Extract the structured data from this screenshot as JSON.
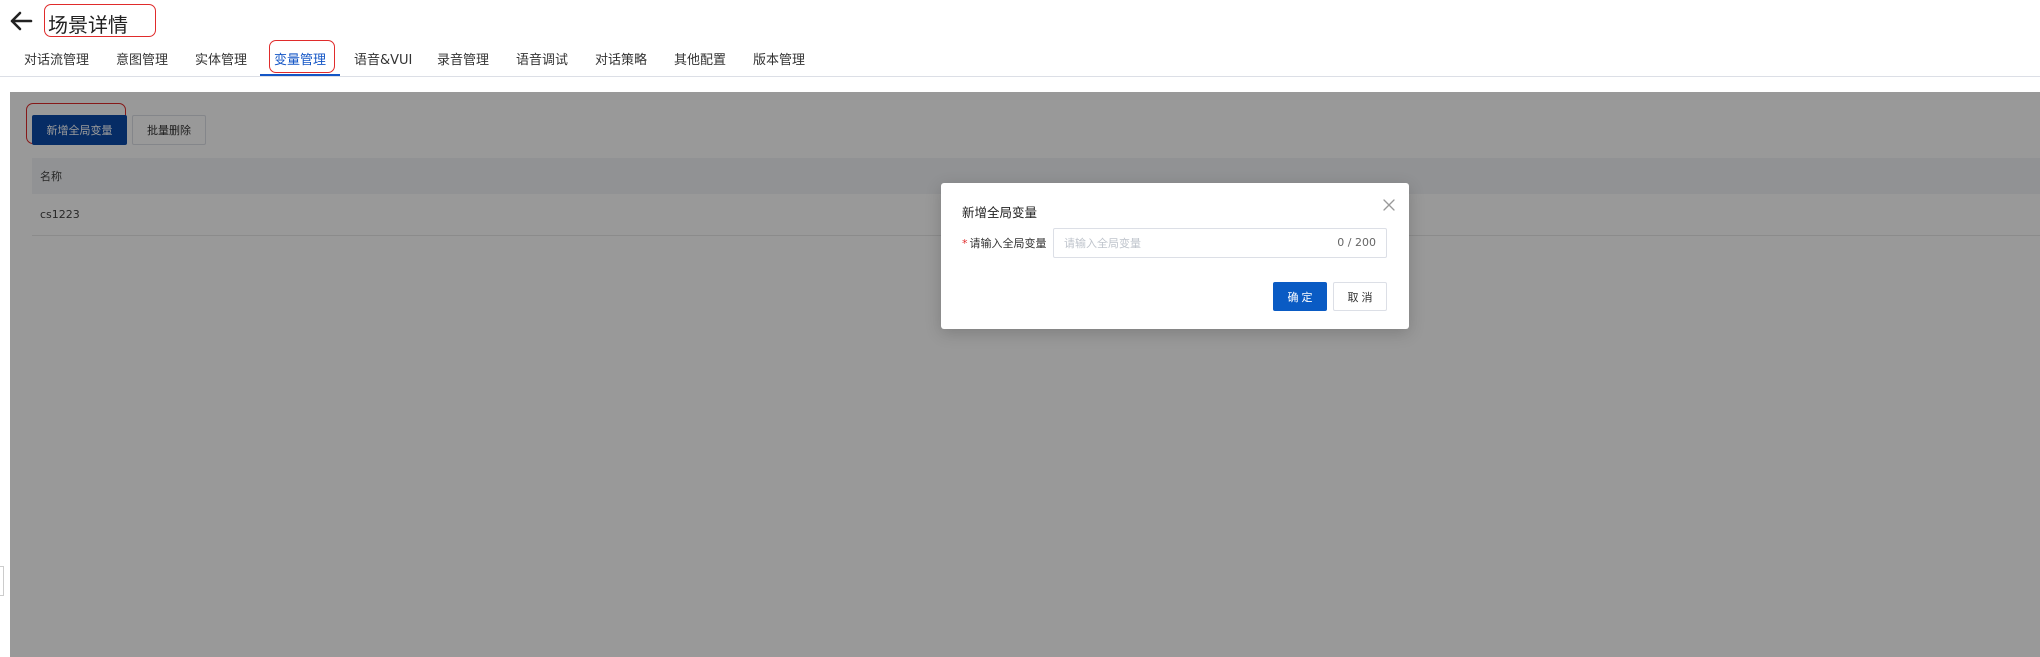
{
  "header": {
    "back_icon": "arrow-left-icon",
    "title": "场景详情"
  },
  "tabs": [
    {
      "label": "对话流管理",
      "active": false
    },
    {
      "label": "意图管理",
      "active": false
    },
    {
      "label": "实体管理",
      "active": false
    },
    {
      "label": "变量管理",
      "active": true
    },
    {
      "label": "语音&VUI",
      "active": false
    },
    {
      "label": "录音管理",
      "active": false
    },
    {
      "label": "语音调试",
      "active": false
    },
    {
      "label": "对话策略",
      "active": false
    },
    {
      "label": "其他配置",
      "active": false
    },
    {
      "label": "版本管理",
      "active": false
    }
  ],
  "toolbar": {
    "add_label": "新增全局变量",
    "batch_delete_label": "批量删除"
  },
  "table": {
    "columns": [
      "名称"
    ],
    "rows": [
      [
        "cs1223"
      ]
    ]
  },
  "modal": {
    "title": "新增全局变量",
    "close_icon": "close-icon",
    "field_label": "请输入全局变量",
    "required_mark": "*",
    "input_value": "",
    "input_placeholder": "请输入全局变量",
    "counter": "0 / 200",
    "ok_label": "确定",
    "cancel_label": "取消"
  },
  "colors": {
    "primary": "#0a5bc4",
    "highlight_ring": "#e02b2b",
    "overlay": "rgba(0,0,0,0.40)"
  }
}
